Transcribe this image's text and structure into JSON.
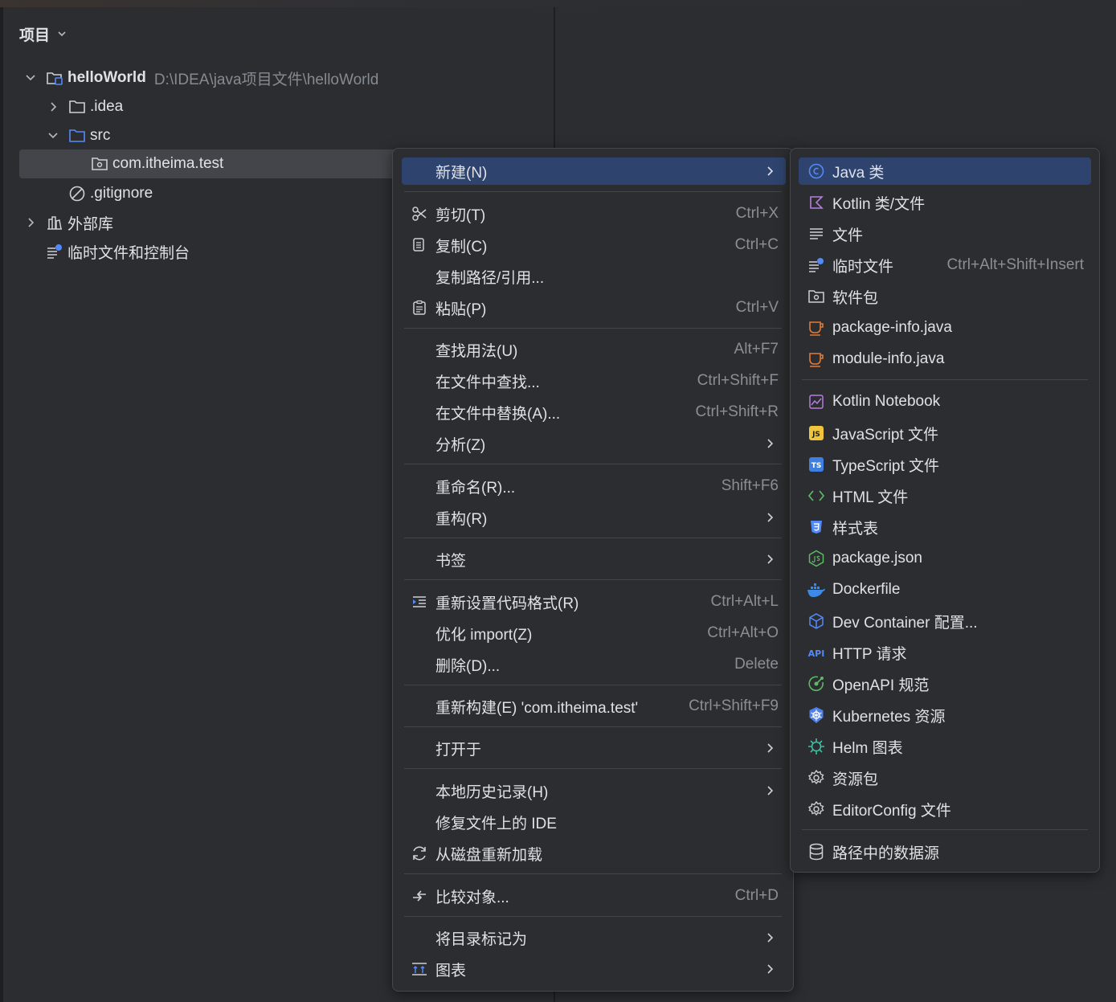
{
  "project_panel": {
    "title": "项目",
    "tree": {
      "root_name": "helloWorld",
      "root_path": "D:\\IDEA\\java项目文件\\helloWorld",
      "idea": ".idea",
      "src": "src",
      "package": "com.itheima.test",
      "gitignore": ".gitignore",
      "external_libs": "外部库",
      "scratches": "临时文件和控制台"
    }
  },
  "context_menu": {
    "new": "新建(N)",
    "cut": "剪切(T)",
    "cut_sc": "Ctrl+X",
    "copy": "复制(C)",
    "copy_sc": "Ctrl+C",
    "copy_path": "复制路径/引用...",
    "paste": "粘贴(P)",
    "paste_sc": "Ctrl+V",
    "find_usages": "查找用法(U)",
    "find_usages_sc": "Alt+F7",
    "find_in_files": "在文件中查找...",
    "find_in_files_sc": "Ctrl+Shift+F",
    "replace_in_files": "在文件中替换(A)...",
    "replace_in_files_sc": "Ctrl+Shift+R",
    "analyze": "分析(Z)",
    "rename": "重命名(R)...",
    "rename_sc": "Shift+F6",
    "refactor": "重构(R)",
    "bookmarks": "书签",
    "reformat": "重新设置代码格式(R)",
    "reformat_sc": "Ctrl+Alt+L",
    "optimize": "优化 import(Z)",
    "optimize_sc": "Ctrl+Alt+O",
    "delete": "删除(D)...",
    "delete_sc": "Delete",
    "rebuild": "重新构建(E) 'com.itheima.test'",
    "rebuild_sc": "Ctrl+Shift+F9",
    "open_in": "打开于",
    "local_history": "本地历史记录(H)",
    "repair_ide": "修复文件上的 IDE",
    "reload": "从磁盘重新加载",
    "compare": "比较对象...",
    "compare_sc": "Ctrl+D",
    "mark_dir": "将目录标记为",
    "diagrams": "图表"
  },
  "new_submenu": {
    "java_class": "Java 类",
    "kotlin": "Kotlin 类/文件",
    "file": "文件",
    "scratch": "临时文件",
    "scratch_sc": "Ctrl+Alt+Shift+Insert",
    "package": "软件包",
    "package_info": "package-info.java",
    "module_info": "module-info.java",
    "kotlin_notebook": "Kotlin Notebook",
    "js": "JavaScript 文件",
    "ts": "TypeScript 文件",
    "html": "HTML 文件",
    "stylesheet": "样式表",
    "package_json": "package.json",
    "dockerfile": "Dockerfile",
    "devcontainer": "Dev Container 配置...",
    "http": "HTTP 请求",
    "openapi": "OpenAPI 规范",
    "kubernetes": "Kubernetes 资源",
    "helm": "Helm 图表",
    "resource_bundle": "资源包",
    "editorconfig": "EditorConfig 文件",
    "datasource": "路径中的数据源"
  },
  "icons": {
    "js_badge": "JS",
    "ts_badge": "TS",
    "api_badge": "API"
  },
  "colors": {
    "background": "#2b2d30",
    "highlight": "#2e436e",
    "selection": "#43454a",
    "accent_blue": "#548af7",
    "text": "#dfe1e5",
    "muted": "#868a91"
  }
}
